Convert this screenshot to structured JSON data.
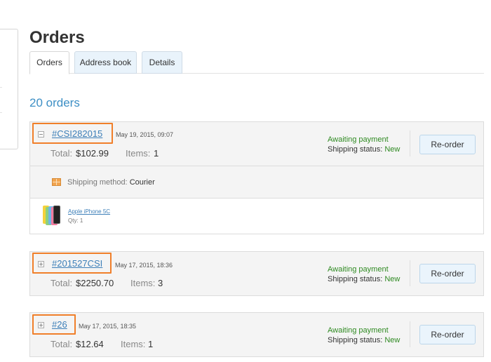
{
  "page": {
    "title": "Orders"
  },
  "tabs": [
    {
      "label": "Orders",
      "active": true
    },
    {
      "label": "Address book",
      "active": false
    },
    {
      "label": "Details",
      "active": false
    }
  ],
  "orders_count": "20 orders",
  "orders": [
    {
      "number": "#CSI282015",
      "date": "May 19, 2015, 09:07",
      "total_label": "Total:",
      "total": "$102.99",
      "items_label": "Items:",
      "items": "1",
      "status": "Awaiting payment",
      "shipping_status_label": "Shipping status:",
      "shipping_status": "New",
      "reorder_label": "Re-order",
      "expanded": true,
      "shipping_method_label": "Shipping method:",
      "shipping_method": "Courier",
      "products": [
        {
          "name": "Apple iPhone 5C",
          "qty": "Qty: 1"
        }
      ]
    },
    {
      "number": "#201527CSI",
      "date": "May 17, 2015, 18:36",
      "total_label": "Total:",
      "total": "$2250.70",
      "items_label": "Items:",
      "items": "3",
      "status": "Awaiting payment",
      "shipping_status_label": "Shipping status:",
      "shipping_status": "New",
      "reorder_label": "Re-order",
      "expanded": false
    },
    {
      "number": "#26",
      "date": "May 17, 2015, 18:35",
      "total_label": "Total:",
      "total": "$12.64",
      "items_label": "Items:",
      "items": "1",
      "status": "Awaiting payment",
      "shipping_status_label": "Shipping status:",
      "shipping_status": "New",
      "reorder_label": "Re-order",
      "expanded": false
    }
  ],
  "colors": {
    "highlight": "#f07f2a",
    "link": "#3d7fb8",
    "status_green": "#2f8a22",
    "button_bg": "#eaf4fc"
  },
  "icons": {
    "collapse": "minus-box-icon",
    "expand": "plus-box-icon",
    "shipping": "package-icon",
    "product": "iphone-5c-thumbnail"
  }
}
